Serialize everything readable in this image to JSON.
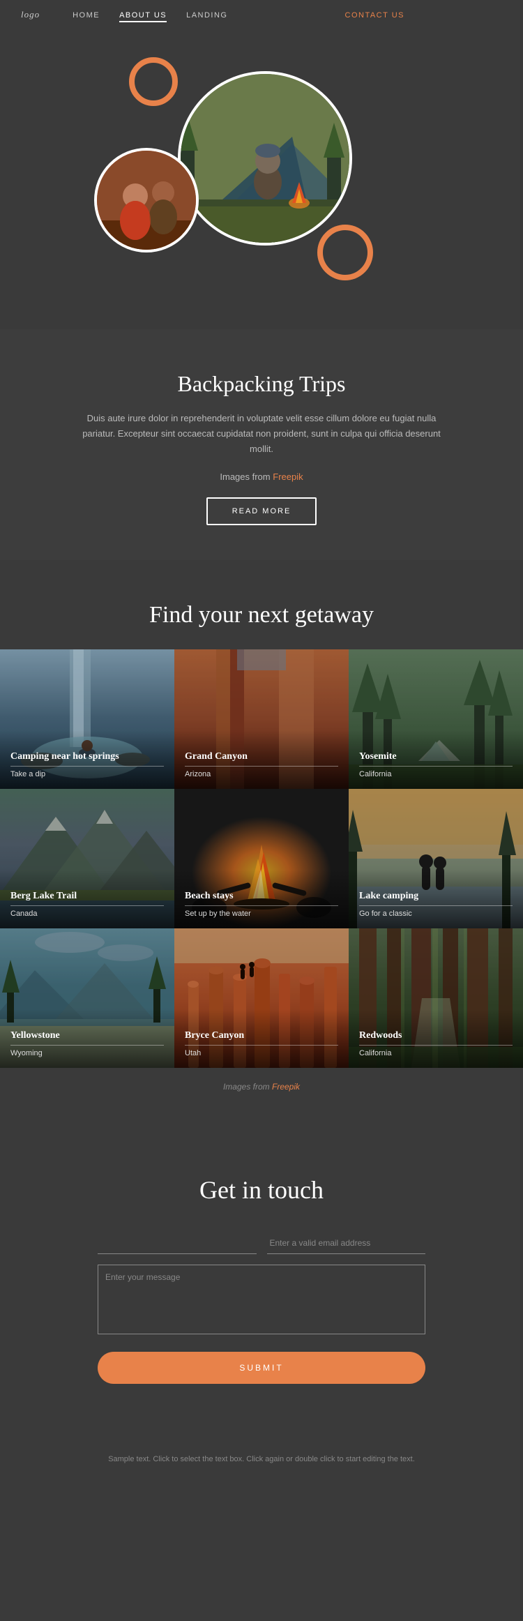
{
  "nav": {
    "logo": "logo",
    "links": [
      {
        "label": "HOME",
        "active": false
      },
      {
        "label": "ABOUT US",
        "active": true
      },
      {
        "label": "LANDING",
        "active": false
      },
      {
        "label": "CONTACT US",
        "active": false,
        "highlight": true
      }
    ]
  },
  "hero": {
    "deco_rings": [
      "orange ring top-left",
      "orange ring bottom-right"
    ]
  },
  "backpacking": {
    "title": "Backpacking Trips",
    "description": "Duis aute irure dolor in reprehenderit in voluptate velit esse cillum dolore eu fugiat nulla pariatur. Excepteur sint occaecat cupidatat non proident, sunt in culpa qui officia deserunt mollit.",
    "images_credit": "Images from",
    "images_link_text": "Freepik",
    "read_more": "READ MORE"
  },
  "getaway": {
    "title": "Find your next getaway",
    "grid": [
      {
        "name": "Camping near hot springs",
        "sub": "Take a dip",
        "bg": "hot-springs"
      },
      {
        "name": "Grand Canyon",
        "sub": "Arizona",
        "bg": "grand-canyon"
      },
      {
        "name": "Yosemite",
        "sub": "California",
        "bg": "yosemite"
      },
      {
        "name": "Berg Lake Trail",
        "sub": "Canada",
        "bg": "berg-lake"
      },
      {
        "name": "Beach stays",
        "sub": "Set up by the water",
        "bg": "beach"
      },
      {
        "name": "Lake camping",
        "sub": "Go for a classic",
        "bg": "lake-camping"
      },
      {
        "name": "Yellowstone",
        "sub": "Wyoming",
        "bg": "yellowstone"
      },
      {
        "name": "Bryce Canyon",
        "sub": "Utah",
        "bg": "bryce-canyon"
      },
      {
        "name": "Redwoods",
        "sub": "California",
        "bg": "redwoods"
      }
    ],
    "images_credit": "Images from",
    "images_link_text": "Freepik"
  },
  "contact": {
    "title": "Get in touch",
    "name_placeholder": "",
    "email_placeholder": "Enter a valid email address",
    "message_placeholder": "Enter your message",
    "submit_label": "SUBMIT"
  },
  "footer": {
    "text": "Sample text. Click to select the text box. Click again or double click to start editing the text."
  }
}
